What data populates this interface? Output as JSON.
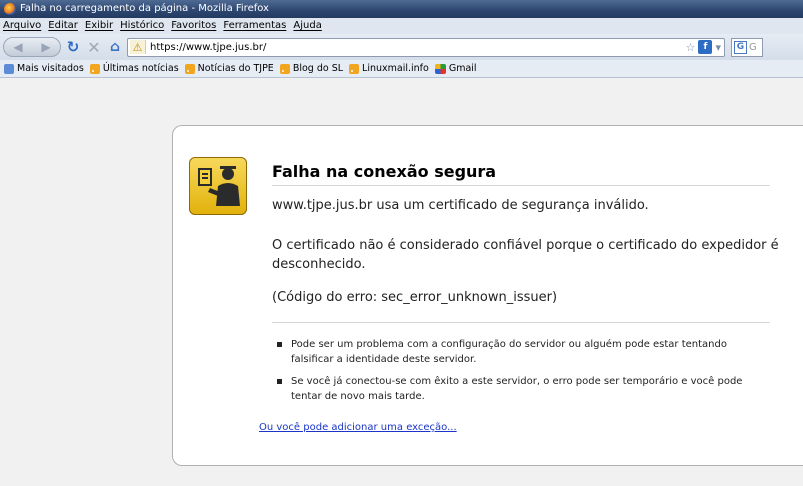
{
  "window": {
    "title": "Falha no carregamento da página - Mozilla Firefox"
  },
  "menu": [
    "Arquivo",
    "Editar",
    "Exibir",
    "Histórico",
    "Favoritos",
    "Ferramentas",
    "Ajuda"
  ],
  "navbar": {
    "url": "https://www.tjpe.jus.br/",
    "search_placeholder": "G"
  },
  "bookmarks": [
    "Mais visitados",
    "Últimas notícias",
    "Notícias do TJPE",
    "Blog do SL",
    "Linuxmail.info",
    "Gmail"
  ],
  "error": {
    "title": "Falha na conexão segura",
    "p1": "www.tjpe.jus.br usa um certificado de segurança inválido.",
    "p2": "O certificado não é considerado confiável porque o certificado do expedidor é desconhecido.",
    "p3": "(Código do erro: sec_error_unknown_issuer)",
    "bullets": [
      "Pode ser um problema com a configuração do servidor ou alguém pode estar tentando falsificar a identidade deste servidor.",
      "Se você já conectou-se com êxito a este servidor, o erro pode ser temporário e você pode tentar de novo mais tarde."
    ],
    "exception_link": "Ou você pode adicionar uma exceção..."
  }
}
